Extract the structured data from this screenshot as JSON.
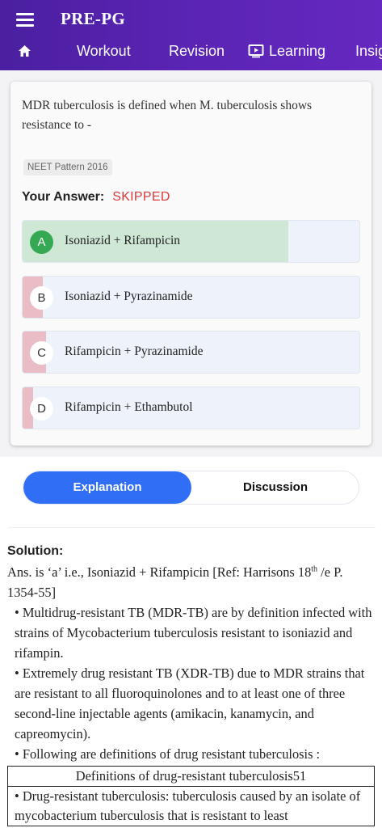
{
  "app": {
    "title": "PRE-PG"
  },
  "nav": {
    "tabs": [
      {
        "label": "Workout"
      },
      {
        "label": "Revision"
      },
      {
        "label": "Learning"
      },
      {
        "label": "Insig"
      }
    ]
  },
  "question": {
    "text": "MDR tuberculosis is defined when M. tuberculosis shows resistance to -",
    "tag": "NEET Pattern 2016",
    "your_answer_label": "Your Answer:",
    "your_answer_value": "SKIPPED",
    "options": [
      {
        "letter": "A",
        "text": "Isoniazid + Rifampicin",
        "percent": 79,
        "correct": true
      },
      {
        "letter": "B",
        "text": "Isoniazid + Pyrazinamide",
        "percent": 6,
        "correct": false
      },
      {
        "letter": "C",
        "text": "Rifampicin + Pyrazinamide",
        "percent": 7,
        "correct": false
      },
      {
        "letter": "D",
        "text": "Rifampicin + Ethambutol",
        "percent": 3,
        "correct": false
      }
    ]
  },
  "colors": {
    "correct_fill": "#cfe8d5",
    "wrong_fill": "#e9bcc6",
    "accent": "#2f6ef5",
    "skipped": "#d9393a"
  },
  "segment": {
    "explanation": "Explanation",
    "discussion": "Discussion"
  },
  "solution": {
    "label": "Solution:",
    "answer_prefix": "Ans. is ‘a’ i.e., Isoniazid + Rifampicin [Ref: Harrisons 18",
    "answer_sup": "th",
    "answer_suffix": " /e P. 1354-55]",
    "bullets": [
      "• Multidrug-resistant TB (MDR-TB) are by definition infected with strains of Mycobacterium tuberculosis resistant to isoniazid and rifampin.",
      "• Extremely drug resistant TB (XDR-TB) due to MDR strains that are resistant to all fluoroquinolones and to at least one of three second-line injectable agents (amikacin, kanamycin, and capreomycin).",
      "• Following are definitions of drug resistant tuberculosis :"
    ],
    "table_header": "Definitions of drug-resistant tuberculosis51",
    "table_row": "• Drug-resistant tuberculosis: tuberculosis caused by an isolate of mycobacterium tuberculosis that is resistant to least"
  }
}
